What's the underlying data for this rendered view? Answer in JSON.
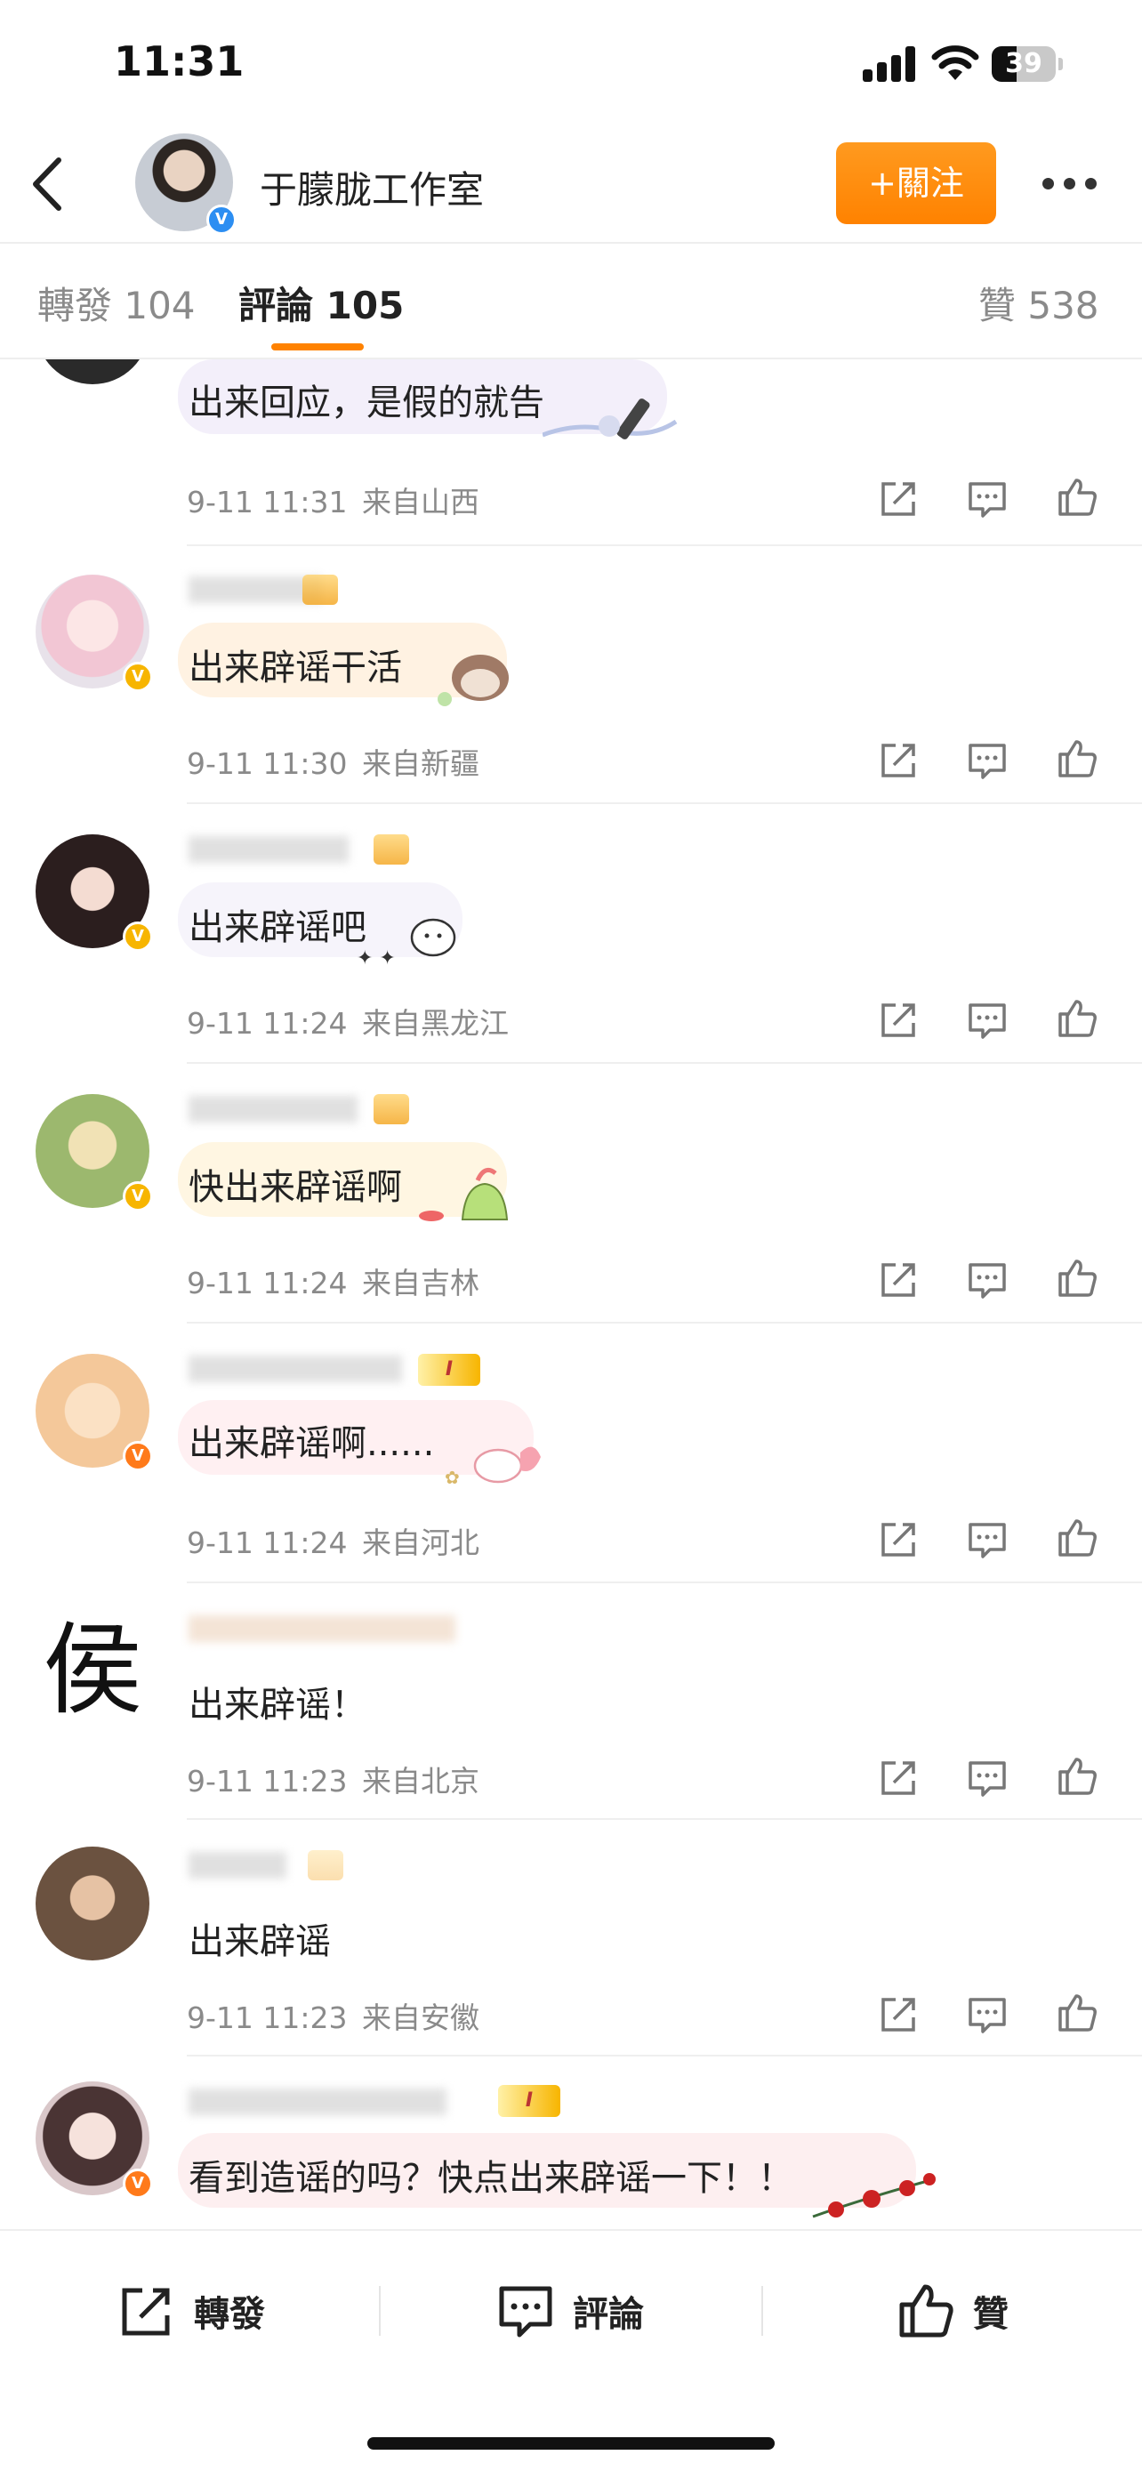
{
  "status_bar": {
    "time": "11:31",
    "battery": "39",
    "battery_level": 0.39
  },
  "header": {
    "title": "于朦胧工作室",
    "follow_label": "+關注",
    "verified_badge": "V"
  },
  "tabs": {
    "repost": "轉發 104",
    "comments": "評論 105",
    "likes": "贊 538"
  },
  "comments": [
    {
      "text": "出来回应，是假的就告",
      "time": "9-11 11:31",
      "location": "来自山西",
      "badge": "",
      "bubble_color": "#f3effa",
      "avatar_color": "#2a2a2a"
    },
    {
      "text": "出来辟谣干活",
      "time": "9-11 11:30",
      "location": "来自新疆",
      "badge": "V",
      "bubble_color": "#fff2e2",
      "avatar_color": "#f2c6d4"
    },
    {
      "text": "出来辟谣吧",
      "time": "9-11 11:24",
      "location": "来自黑龙江",
      "badge": "V",
      "bubble_color": "#f6f4fb",
      "avatar_color": "#3a2a2a"
    },
    {
      "text": "快出来辟谣啊",
      "time": "9-11 11:24",
      "location": "来自吉林",
      "badge": "V",
      "bubble_color": "#fff6e2",
      "avatar_color": "#9cb86e"
    },
    {
      "text": "出来辟谣啊......",
      "time": "9-11 11:24",
      "location": "来自河北",
      "badge": "V",
      "bubble_color": "#fff0f2",
      "avatar_color": "#f4c89a",
      "level": "I"
    },
    {
      "text": "出来辟谣！",
      "time": "9-11 11:23",
      "location": "来自北京",
      "badge": "",
      "avatar_char": "侯",
      "avatar_color": "#ffffff"
    },
    {
      "text": "出来辟谣",
      "time": "9-11 11:23",
      "location": "来自安徽",
      "badge": "",
      "avatar_color": "#6b5240"
    },
    {
      "text": "看到造谣的吗？快点出来辟谣一下！！",
      "time": "",
      "location": "",
      "badge": "V",
      "bubble_color": "#fdeff0",
      "avatar_color": "#d9c7c9",
      "level": "I"
    }
  ],
  "bottom_bar": {
    "repost_label": "轉發",
    "comment_label": "評論",
    "like_label": "贊"
  },
  "colors": {
    "accent": "#ff8200",
    "verified_blue": "#2c8ef2",
    "verified_gold": "#f7b500",
    "meta_gray": "#8a8a8a"
  }
}
